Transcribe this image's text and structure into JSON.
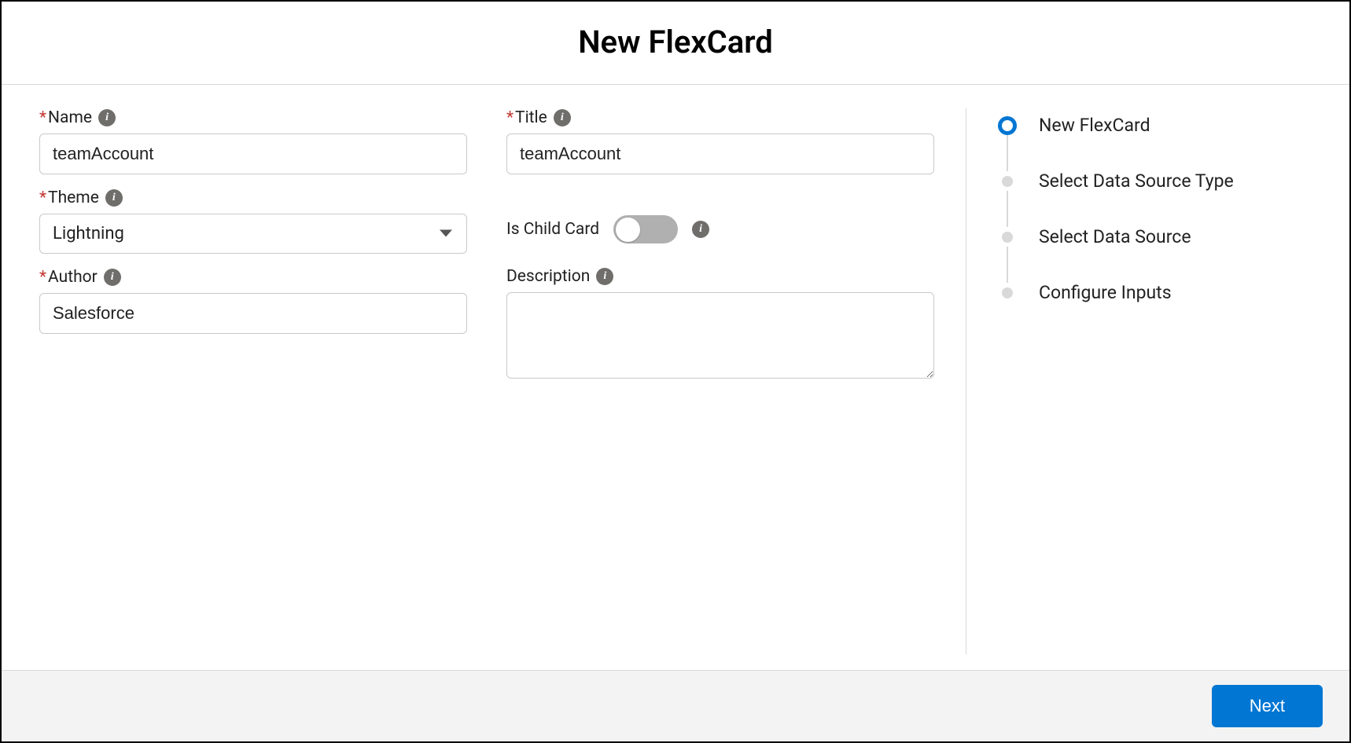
{
  "header": {
    "title": "New FlexCard"
  },
  "form": {
    "left": {
      "name": {
        "label": "Name",
        "required": true,
        "value": "teamAccount"
      },
      "theme": {
        "label": "Theme",
        "required": true,
        "value": "Lightning"
      },
      "author": {
        "label": "Author",
        "required": true,
        "value": "Salesforce"
      }
    },
    "right": {
      "title_field": {
        "label": "Title",
        "required": true,
        "value": "teamAccount"
      },
      "child_card": {
        "label": "Is Child Card",
        "value": false
      },
      "description": {
        "label": "Description",
        "value": ""
      }
    }
  },
  "steps": [
    {
      "label": "New FlexCard",
      "state": "active"
    },
    {
      "label": "Select Data Source Type",
      "state": "pending"
    },
    {
      "label": "Select Data Source",
      "state": "pending"
    },
    {
      "label": "Configure Inputs",
      "state": "pending"
    }
  ],
  "footer": {
    "next": "Next"
  },
  "colors": {
    "accent": "#0176d3",
    "required": "#c23934"
  }
}
